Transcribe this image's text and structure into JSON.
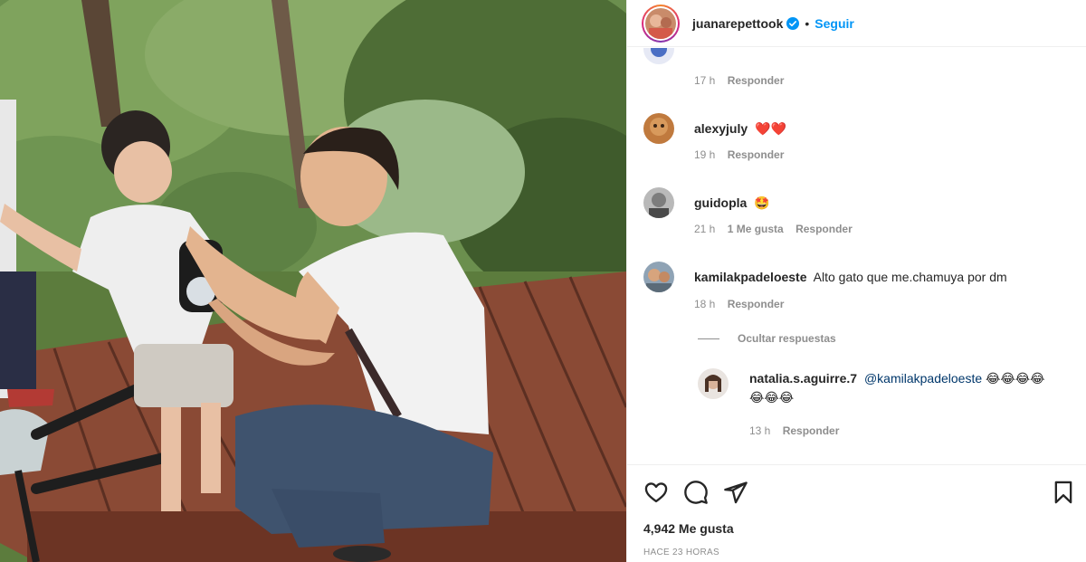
{
  "post": {
    "author": "juanarepettook",
    "follow_label": "Seguir",
    "separator": "•"
  },
  "comments": [
    {
      "meta_time": "17 h",
      "reply_label": "Responder"
    },
    {
      "user": "alexyjuly",
      "text": "❤️❤️",
      "meta_time": "19 h",
      "reply_label": "Responder"
    },
    {
      "user": "guidopla",
      "text": "🤩",
      "meta_time": "21 h",
      "likes": "1 Me gusta",
      "reply_label": "Responder"
    },
    {
      "user": "kamilakpadeloeste",
      "text": "Alto gato que me.chamuya por dm",
      "meta_time": "18 h",
      "reply_label": "Responder"
    }
  ],
  "hide_replies_label": "Ocultar respuestas",
  "reply": {
    "user": "natalia.s.aguirre.7",
    "mention": "@kamilakpadeloeste",
    "emojis_line1": "😂😂😂😂",
    "emojis_line2": "😂😂😂",
    "meta_time": "13 h",
    "reply_label": "Responder"
  },
  "footer": {
    "likes": "4,942 Me gusta",
    "time_ago": "HACE 23 HORAS"
  },
  "icons": {
    "like": "heart-icon",
    "comment": "comment-bubble-icon",
    "share": "paper-plane-icon",
    "save": "bookmark-icon",
    "verified": "verified-badge-icon"
  },
  "colors": {
    "accent": "#0095f6",
    "text": "#262626",
    "muted": "#8e8e8e",
    "verified": "#0095f6"
  }
}
